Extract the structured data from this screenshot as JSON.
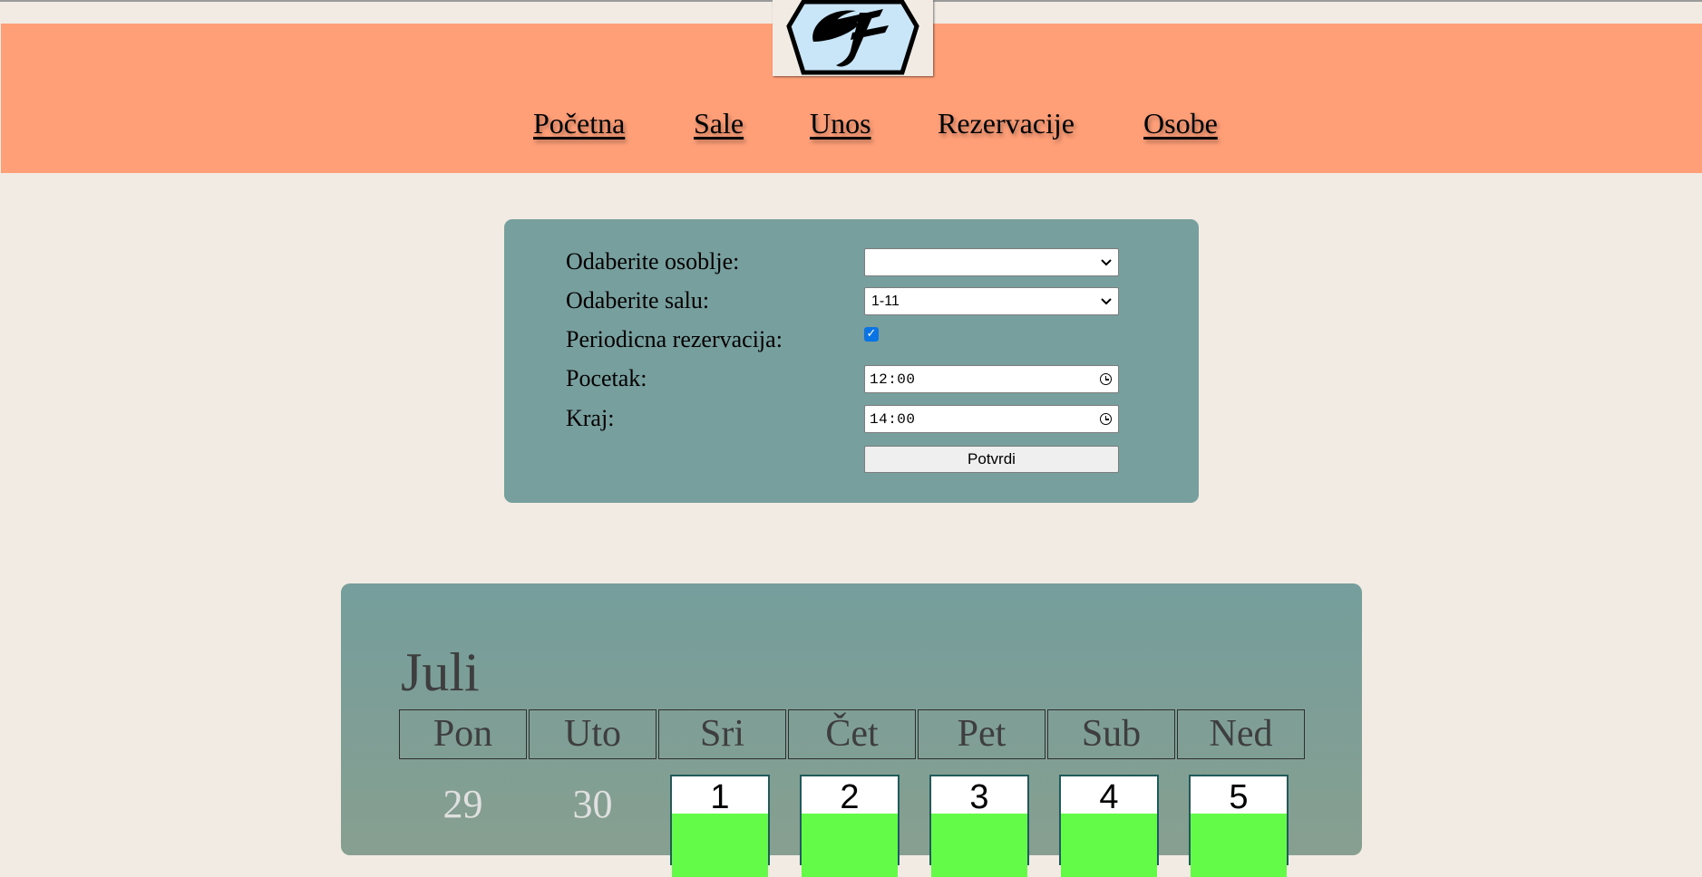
{
  "nav": {
    "items": [
      {
        "label": "Početna",
        "active": false
      },
      {
        "label": "Sale",
        "active": false
      },
      {
        "label": "Unos",
        "active": false
      },
      {
        "label": "Rezervacije",
        "active": true
      },
      {
        "label": "Osobe",
        "active": false
      }
    ]
  },
  "form": {
    "staff_label": "Odaberite osoblje:",
    "staff_value": "",
    "room_label": "Odaberite salu:",
    "room_value": "1-11",
    "periodic_label": "Periodicna rezervacija:",
    "periodic_checked": true,
    "start_label": "Pocetak:",
    "start_value": "12:00",
    "end_label": "Kraj:",
    "end_value": "14:00",
    "submit_label": "Potvrdi"
  },
  "calendar": {
    "month": "Juli",
    "weekdays": [
      "Pon",
      "Uto",
      "Sri",
      "Čet",
      "Pet",
      "Sub",
      "Ned"
    ],
    "prev_month_days": [
      "29",
      "30"
    ],
    "days": [
      "1",
      "2",
      "3",
      "4",
      "5"
    ],
    "available_color": "#63fb47"
  },
  "colors": {
    "header": "#ff9f78",
    "panel": "#769f9e",
    "background": "#f2ebe4"
  }
}
